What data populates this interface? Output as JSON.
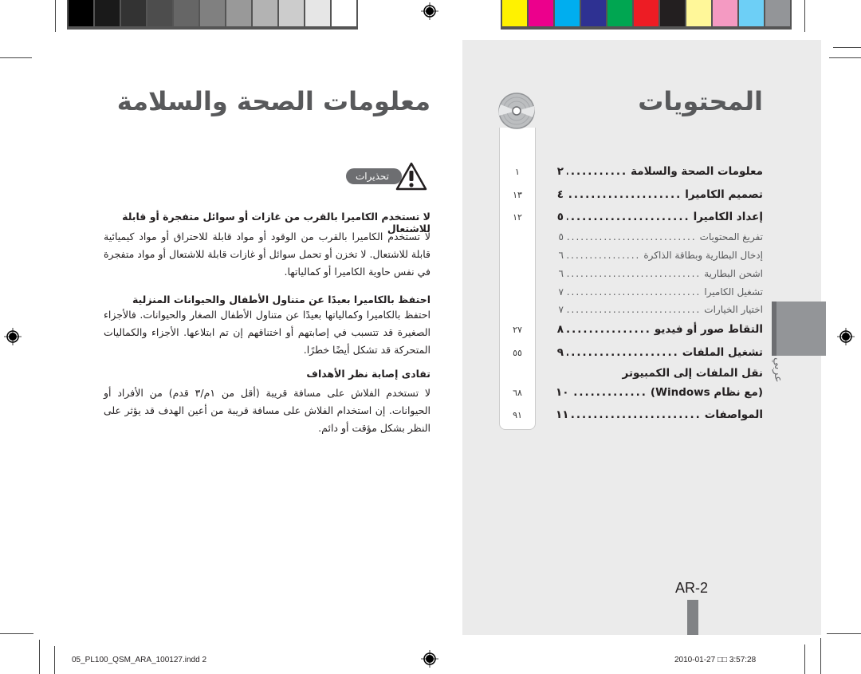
{
  "colors": {
    "grayscale_bar": [
      "#000000",
      "#1a1a1a",
      "#333333",
      "#4d4d4d",
      "#666666",
      "#808080",
      "#999999",
      "#b3b3b3",
      "#cccccc",
      "#e6e6e6",
      "#ffffff"
    ],
    "color_bar": [
      "#fff200",
      "#ec008c",
      "#00aeef",
      "#2e3192",
      "#00a651",
      "#ed1c24",
      "#231f20",
      "#fff799",
      "#f49ac2",
      "#6dcff6",
      "#939598"
    ],
    "panel_bg": "#ebebeb",
    "accent_gray": "#939598"
  },
  "left_page": {
    "title": "معلومات الصحة والسلامة",
    "warning_label": "تحذيرات",
    "sections": [
      {
        "heading": "لا تستخدم الكاميرا بالقرب من غازات أو سوائل متفجرة أو قابلة للاشتعال",
        "body": "لا تستخدم الكاميرا بالقرب من الوقود أو مواد قابلة للاحتراق أو مواد كيميائية قابلة للاشتعال. لا تخزن أو تحمل سوائل أو غازات قابلة للاشتعال أو مواد متفجرة في نفس حاوية الكاميرا أو كمالياتها."
      },
      {
        "heading": "احتفظ بالكاميرا بعيدًا عن متناول الأطفال والحيوانات المنزلية",
        "body": "احتفظ بالكاميرا وكمالياتها بعيدًا عن متناول الأطفال الصغار والحيوانات. فالأجزاء الصغيرة قد تتسبب في إصابتهم أو اختناقهم إن تم ابتلاعها. الأجزاء والكماليات المتحركة قد تشكل أيضًا خطرًا."
      },
      {
        "heading": "تفادى إصابة نظر الأهداف",
        "body": "لا تستخدم الفلاش على مسافة قريبة (أقل من ١م/٣ قدم) من الأفراد أو الحيوانات. إن استخدام الفلاش على مسافة قريبة من أعين الهدف قد يؤثر على النظر بشكل مؤقت أو دائم."
      }
    ]
  },
  "right_page": {
    "title": "المحتويات",
    "toc": [
      {
        "label": "معلومات الصحة والسلامة",
        "page": "٢",
        "side": "١",
        "level": "main"
      },
      {
        "label": "تصميم الكاميرا",
        "page": "٤",
        "side": "١٣",
        "level": "main"
      },
      {
        "label": "إعداد الكاميرا",
        "page": "٥",
        "side": "١٢",
        "level": "main"
      },
      {
        "label": "تفريغ المحتويات",
        "page": "٥",
        "side": "",
        "level": "sub"
      },
      {
        "label": "إدخال البطارية وبطاقة الذاكرة",
        "page": "٦",
        "side": "",
        "level": "sub"
      },
      {
        "label": "اشحن البطارية",
        "page": "٦",
        "side": "",
        "level": "sub"
      },
      {
        "label": "تشغيل الكاميرا",
        "page": "٧",
        "side": "",
        "level": "sub"
      },
      {
        "label": "اختيار الخيارات",
        "page": "٧",
        "side": "",
        "level": "sub"
      },
      {
        "label": "التقاط صور أو فيديو",
        "page": "٨",
        "side": "٢٧",
        "level": "main"
      },
      {
        "label": "تشغيل الملفات",
        "page": "٩",
        "side": "٥٥",
        "level": "main"
      },
      {
        "label": "نقل الملفات إلى الكمبيوتر",
        "page": "",
        "side": "",
        "level": "main"
      },
      {
        "label": "(مع نظام Windows)",
        "page": "١٠",
        "side": "٦٨",
        "level": "main"
      },
      {
        "label": "المواصفات",
        "page": "١١",
        "side": "٩١",
        "level": "main"
      }
    ],
    "language_tab": "عربي",
    "page_number": "AR-2"
  },
  "print_slug": {
    "file": "05_PL100_QSM_ARA_100127.indd   2",
    "date": "2010-01-27",
    "time_glyphs": "□□",
    "time": "3:57:28"
  }
}
